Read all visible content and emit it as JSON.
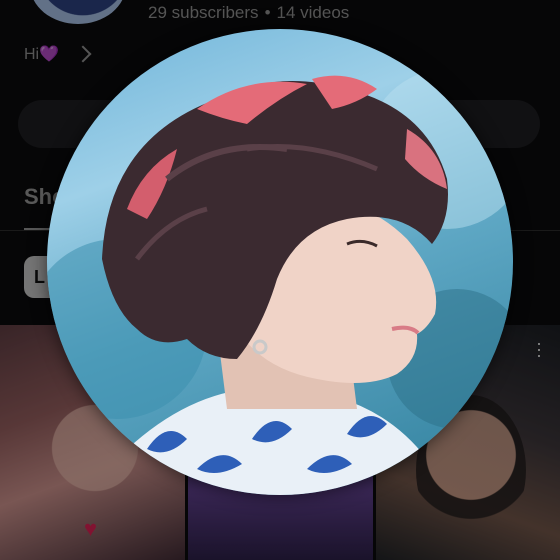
{
  "channel": {
    "subscribers": "29 subscribers",
    "separator": "•",
    "videos": "14 videos",
    "bio": "Hi💜"
  },
  "tabs": {
    "active_label": "Sho"
  },
  "chips": {
    "first_label": "L"
  },
  "icons": {
    "bio_more": "chevron-right-icon",
    "thumbnail_menu": "more-vert-icon",
    "heart": "heart-icon"
  },
  "profile_photo": {
    "description_icon": "profile-avatar-enlarged"
  }
}
